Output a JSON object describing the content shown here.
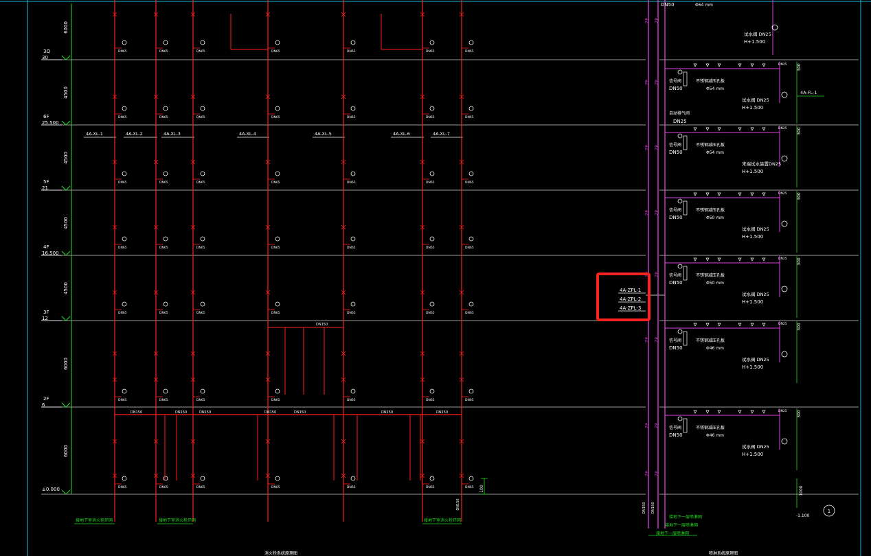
{
  "colors": {
    "background": "#000000",
    "pipe_red": "#ff2020",
    "pipe_magenta": "#e040e0",
    "floor_line": "#cfcfcf",
    "dim_green": "#22dd22",
    "text_white": "#ffffff",
    "highlight": "#ff2020",
    "frame_cyan": "#22bbdd"
  },
  "floors": [
    {
      "name": "2F",
      "elev": "6"
    },
    {
      "name": "3F",
      "elev": "12"
    },
    {
      "name": "4F",
      "elev": "16.500"
    },
    {
      "name": "5F",
      "elev": "21"
    },
    {
      "name": "6F",
      "elev": "25.500"
    },
    {
      "name": "3Q",
      "elev": "30"
    }
  ],
  "ground_elev": "±0.000",
  "floor_heights": [
    "6000",
    "4500",
    "4500",
    "4500",
    "4500",
    "6000",
    "6000"
  ],
  "riser_labels": [
    "4A-XL-1",
    "4A-XL-2",
    "4A-XL-3",
    "4A-XL-4",
    "4A-XL-5",
    "4A-XL-6",
    "4A-XL-7"
  ],
  "dn_labels": {
    "dn65": "DN65",
    "dn150": "DN150",
    "dn50": "DN50",
    "dn25": "DN25",
    "dn_riser": "DN150"
  },
  "bottom_labels": [
    "接地下室消火栓环网",
    "接地下室消火栓环网",
    "接地下室消火栓环网"
  ],
  "zpl": {
    "labels": [
      "4A-ZPL-1",
      "4A-ZPL-2",
      "4A-ZPL-3"
    ],
    "riser_code": "ZP",
    "top_dn": "DN50",
    "top_size": "Φ64 mm"
  },
  "fl_label": "4A-FL-1",
  "auto_vent": {
    "label": "自动排气阀",
    "dn": "DN25"
  },
  "zone_blocks": [
    {
      "valve": "信号阀",
      "dn": "DN50",
      "orifice": "不锈钢减压孔板",
      "size": "Φ54 mm",
      "test": "试水阀 DN25",
      "height": "H+1.500"
    },
    {
      "valve": "信号阀",
      "dn": "DN50",
      "orifice": "不锈钢减压孔板",
      "size": "Φ54 mm",
      "test": "末端试水装置DN25",
      "height": "H+1.500"
    },
    {
      "valve": "信号阀",
      "dn": "DN50",
      "orifice": "不锈钢减压孔板",
      "size": "Φ50 mm",
      "test": "试水阀 DN25",
      "height": "H+1.500"
    },
    {
      "valve": "信号阀",
      "dn": "DN50",
      "orifice": "不锈钢减压孔板",
      "size": "Φ50 mm",
      "test": "试水阀 DN25",
      "height": "H+1.500"
    },
    {
      "valve": "信号阀",
      "dn": "DN50",
      "orifice": "不锈钢减压孔板",
      "size": "Φ46 mm",
      "test": "试水阀 DN25",
      "height": "H+1.500"
    },
    {
      "valve": "信号阀",
      "dn": "DN50",
      "orifice": "不锈钢减压孔板",
      "size": "Φ46 mm",
      "test": "试水阀 DN25",
      "height": "H+1.500"
    }
  ],
  "top_block": {
    "test": "试水阀 DN25",
    "height": "H+1.500"
  },
  "right_bottom_labels": [
    "接地下一层喷淋网",
    "接地下一层喷淋网",
    "接地下一层喷淋网"
  ],
  "right_misc": {
    "dim_300": "300",
    "dim_100": "100",
    "dim_1000": "1000",
    "elev_neg": "-1.100",
    "axis_marker": "1"
  },
  "drawing_titles": [
    "消火栓系统原理图",
    "喷淋系统原理图"
  ]
}
